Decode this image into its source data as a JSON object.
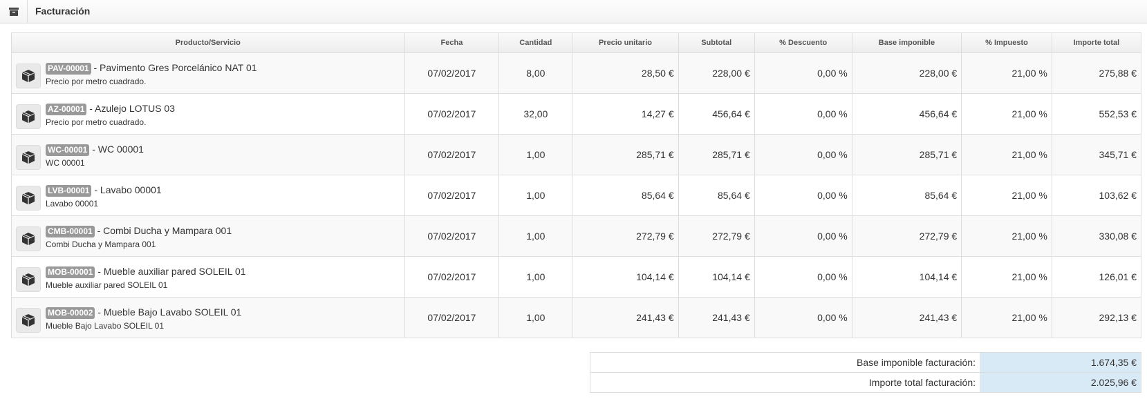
{
  "header": {
    "title": "Facturación",
    "icon": "archive-icon"
  },
  "table": {
    "columns": [
      "Producto/Servicio",
      "Fecha",
      "Cantidad",
      "Precio unitario",
      "Subtotal",
      "% Descuento",
      "Base imponible",
      "% Impuesto",
      "Importe total"
    ],
    "rows": [
      {
        "code": "PAV-00001",
        "name": " - Pavimento Gres Porcelánico NAT 01",
        "desc": "Precio por metro cuadrado.",
        "fecha": "07/02/2017",
        "cantidad": "8,00",
        "precio": "28,50 €",
        "subtotal": "228,00 €",
        "descuento": "0,00 %",
        "base": "228,00 €",
        "impuesto": "21,00 %",
        "total": "275,88 €"
      },
      {
        "code": "AZ-00001",
        "name": " - Azulejo LOTUS 03",
        "desc": "Precio por metro cuadrado.",
        "fecha": "07/02/2017",
        "cantidad": "32,00",
        "precio": "14,27 €",
        "subtotal": "456,64 €",
        "descuento": "0,00 %",
        "base": "456,64 €",
        "impuesto": "21,00 %",
        "total": "552,53 €"
      },
      {
        "code": "WC-00001",
        "name": " - WC 00001",
        "desc": "WC 00001",
        "fecha": "07/02/2017",
        "cantidad": "1,00",
        "precio": "285,71 €",
        "subtotal": "285,71 €",
        "descuento": "0,00 %",
        "base": "285,71 €",
        "impuesto": "21,00 %",
        "total": "345,71 €"
      },
      {
        "code": "LVB-00001",
        "name": " - Lavabo 00001",
        "desc": "Lavabo 00001",
        "fecha": "07/02/2017",
        "cantidad": "1,00",
        "precio": "85,64 €",
        "subtotal": "85,64 €",
        "descuento": "0,00 %",
        "base": "85,64 €",
        "impuesto": "21,00 %",
        "total": "103,62 €"
      },
      {
        "code": "CMB-00001",
        "name": " - Combi Ducha y Mampara 001",
        "desc": "Combi Ducha y Mampara 001",
        "fecha": "07/02/2017",
        "cantidad": "1,00",
        "precio": "272,79 €",
        "subtotal": "272,79 €",
        "descuento": "0,00 %",
        "base": "272,79 €",
        "impuesto": "21,00 %",
        "total": "330,08 €"
      },
      {
        "code": "MOB-00001",
        "name": " - Mueble auxiliar pared SOLEIL 01",
        "desc": "Mueble auxiliar pared SOLEIL 01",
        "fecha": "07/02/2017",
        "cantidad": "1,00",
        "precio": "104,14 €",
        "subtotal": "104,14 €",
        "descuento": "0,00 %",
        "base": "104,14 €",
        "impuesto": "21,00 %",
        "total": "126,01 €"
      },
      {
        "code": "MOB-00002",
        "name": " - Mueble Bajo Lavabo SOLEIL 01",
        "desc": "Mueble Bajo Lavabo SOLEIL 01",
        "fecha": "07/02/2017",
        "cantidad": "1,00",
        "precio": "241,43 €",
        "subtotal": "241,43 €",
        "descuento": "0,00 %",
        "base": "241,43 €",
        "impuesto": "21,00 %",
        "total": "292,13 €"
      }
    ],
    "row_icon": "cube-icon"
  },
  "totals": {
    "base_label": "Base imponible facturación:",
    "base_value": "1.674,35 €",
    "total_label": "Importe total facturación:",
    "total_value": "2.025,96 €"
  },
  "colors": {
    "code_badge": "#999999",
    "totals_value_bg": "#d9eaf7"
  }
}
